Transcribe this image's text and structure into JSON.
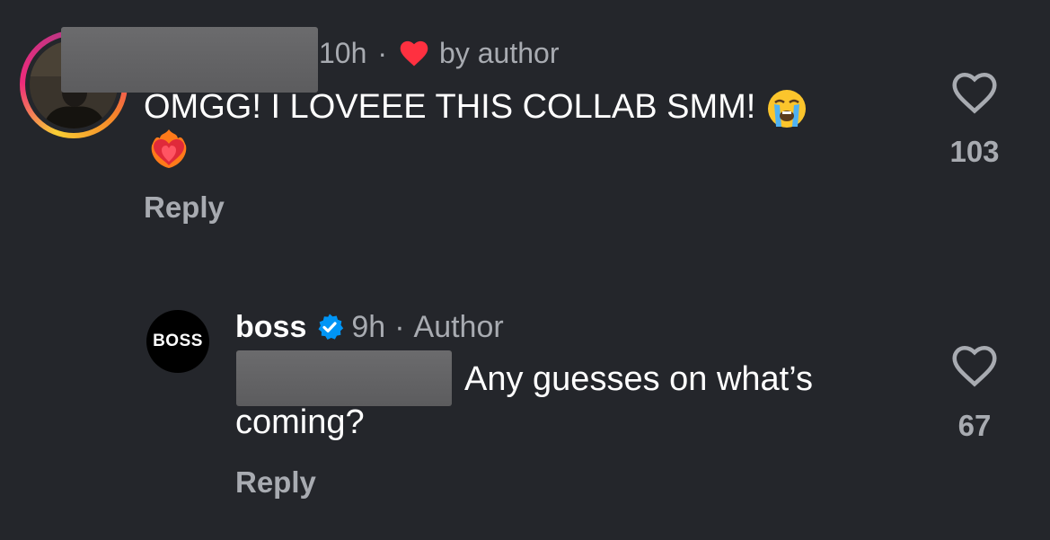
{
  "comment": {
    "username_redacted": true,
    "time": "10h",
    "separator": "·",
    "liked_by_label": "by author",
    "text": "OMGG! I LOVEEE THIS COLLAB SMM!",
    "reply_label": "Reply",
    "like_count": "103",
    "icons": [
      "story-ring-avatar",
      "red-heart-icon",
      "loudly-crying-face-emoji",
      "heart-on-fire-emoji",
      "heart-outline-icon"
    ]
  },
  "reply": {
    "avatar_text": "BOSS",
    "username": "boss",
    "verified": true,
    "time": "9h",
    "separator": "·",
    "author_label": "Author",
    "mention_redacted": true,
    "text_line1": "Any guesses on what’s",
    "text_line2": "coming?",
    "reply_label": "Reply",
    "like_count": "67",
    "icons": [
      "verified-badge-icon",
      "heart-outline-icon"
    ]
  },
  "colors": {
    "background": "#24262b",
    "secondary_text": "#a8abb1",
    "heart_red": "#ff3040",
    "verified_blue": "#0095f6"
  }
}
